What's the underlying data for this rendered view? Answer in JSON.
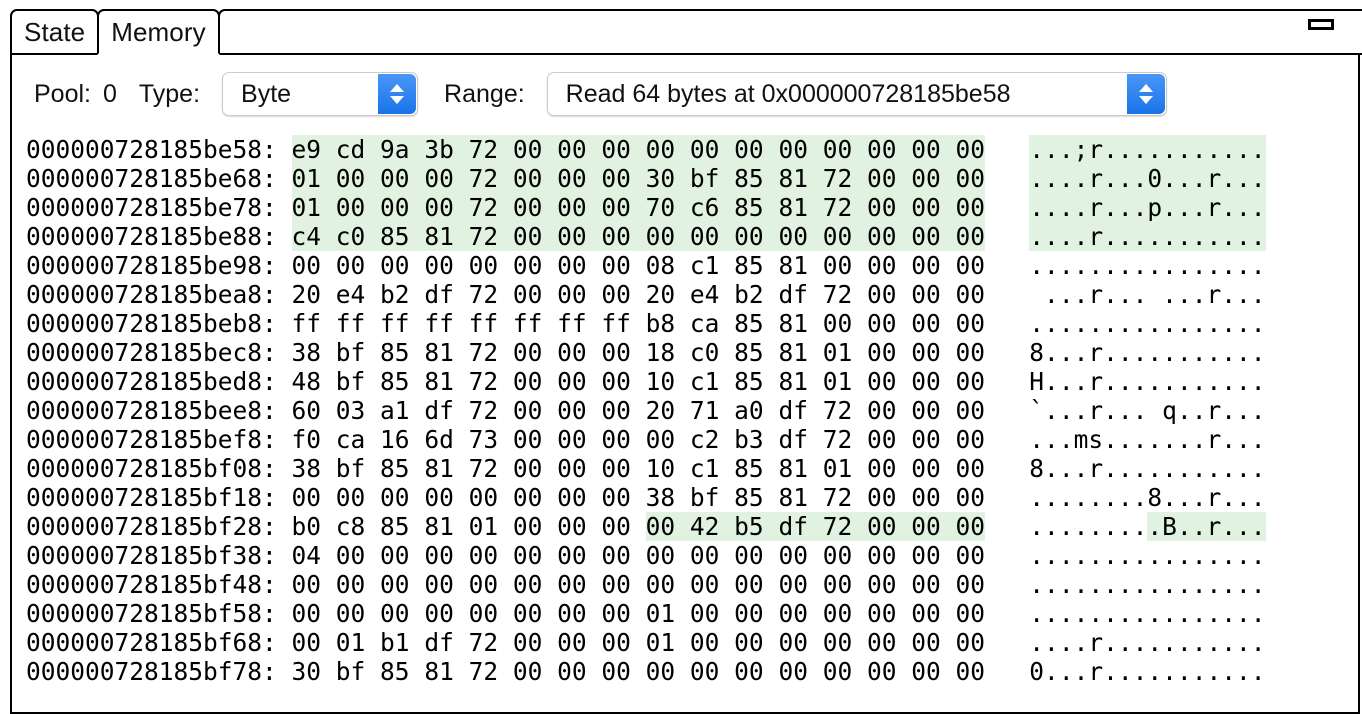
{
  "window": {
    "minimize_icon": "minimize-icon"
  },
  "tabs": [
    {
      "label": "State",
      "active": false
    },
    {
      "label": "Memory",
      "active": true
    }
  ],
  "toolbar": {
    "pool_label": "Pool:",
    "pool_value": "0",
    "type_label": "Type:",
    "type_value": "Byte",
    "type_options": [
      "Byte"
    ],
    "range_label": "Range:",
    "range_value": "Read 64 bytes at 0x000000728185be58",
    "range_options": [
      "Read 64 bytes at 0x000000728185be58"
    ],
    "stepper_icon": "chevron-up-down-icon"
  },
  "colors": {
    "highlight": "#e1f3e0",
    "stepper_blue": "#1a74e8",
    "text": "#000000",
    "background": "#ffffff"
  },
  "memory": {
    "bytes_per_row": 16,
    "rows": [
      {
        "address": "000000728185be58",
        "bytes": [
          "e9",
          "cd",
          "9a",
          "3b",
          "72",
          "00",
          "00",
          "00",
          "00",
          "00",
          "00",
          "00",
          "00",
          "00",
          "00",
          "00"
        ],
        "ascii": "...;r...........",
        "highlight": [
          0,
          16
        ]
      },
      {
        "address": "000000728185be68",
        "bytes": [
          "01",
          "00",
          "00",
          "00",
          "72",
          "00",
          "00",
          "00",
          "30",
          "bf",
          "85",
          "81",
          "72",
          "00",
          "00",
          "00"
        ],
        "ascii": "....r...0...r...",
        "highlight": [
          0,
          16
        ]
      },
      {
        "address": "000000728185be78",
        "bytes": [
          "01",
          "00",
          "00",
          "00",
          "72",
          "00",
          "00",
          "00",
          "70",
          "c6",
          "85",
          "81",
          "72",
          "00",
          "00",
          "00"
        ],
        "ascii": "....r...p...r...",
        "highlight": [
          0,
          16
        ]
      },
      {
        "address": "000000728185be88",
        "bytes": [
          "c4",
          "c0",
          "85",
          "81",
          "72",
          "00",
          "00",
          "00",
          "00",
          "00",
          "00",
          "00",
          "00",
          "00",
          "00",
          "00"
        ],
        "ascii": "....r...........",
        "highlight": [
          0,
          16
        ]
      },
      {
        "address": "000000728185be98",
        "bytes": [
          "00",
          "00",
          "00",
          "00",
          "00",
          "00",
          "00",
          "00",
          "08",
          "c1",
          "85",
          "81",
          "00",
          "00",
          "00",
          "00"
        ],
        "ascii": "................",
        "highlight": null
      },
      {
        "address": "000000728185bea8",
        "bytes": [
          "20",
          "e4",
          "b2",
          "df",
          "72",
          "00",
          "00",
          "00",
          "20",
          "e4",
          "b2",
          "df",
          "72",
          "00",
          "00",
          "00"
        ],
        "ascii": " ...r... ...r...",
        "highlight": null
      },
      {
        "address": "000000728185beb8",
        "bytes": [
          "ff",
          "ff",
          "ff",
          "ff",
          "ff",
          "ff",
          "ff",
          "ff",
          "b8",
          "ca",
          "85",
          "81",
          "00",
          "00",
          "00",
          "00"
        ],
        "ascii": "................",
        "highlight": null
      },
      {
        "address": "000000728185bec8",
        "bytes": [
          "38",
          "bf",
          "85",
          "81",
          "72",
          "00",
          "00",
          "00",
          "18",
          "c0",
          "85",
          "81",
          "01",
          "00",
          "00",
          "00"
        ],
        "ascii": "8...r...........",
        "highlight": null
      },
      {
        "address": "000000728185bed8",
        "bytes": [
          "48",
          "bf",
          "85",
          "81",
          "72",
          "00",
          "00",
          "00",
          "10",
          "c1",
          "85",
          "81",
          "01",
          "00",
          "00",
          "00"
        ],
        "ascii": "H...r...........",
        "highlight": null
      },
      {
        "address": "000000728185bee8",
        "bytes": [
          "60",
          "03",
          "a1",
          "df",
          "72",
          "00",
          "00",
          "00",
          "20",
          "71",
          "a0",
          "df",
          "72",
          "00",
          "00",
          "00"
        ],
        "ascii": "`...r... q..r...",
        "highlight": null
      },
      {
        "address": "000000728185bef8",
        "bytes": [
          "f0",
          "ca",
          "16",
          "6d",
          "73",
          "00",
          "00",
          "00",
          "00",
          "c2",
          "b3",
          "df",
          "72",
          "00",
          "00",
          "00"
        ],
        "ascii": "...ms.......r...",
        "highlight": null
      },
      {
        "address": "000000728185bf08",
        "bytes": [
          "38",
          "bf",
          "85",
          "81",
          "72",
          "00",
          "00",
          "00",
          "10",
          "c1",
          "85",
          "81",
          "01",
          "00",
          "00",
          "00"
        ],
        "ascii": "8...r...........",
        "highlight": null
      },
      {
        "address": "000000728185bf18",
        "bytes": [
          "00",
          "00",
          "00",
          "00",
          "00",
          "00",
          "00",
          "00",
          "38",
          "bf",
          "85",
          "81",
          "72",
          "00",
          "00",
          "00"
        ],
        "ascii": "........8...r...",
        "highlight": null
      },
      {
        "address": "000000728185bf28",
        "bytes": [
          "b0",
          "c8",
          "85",
          "81",
          "01",
          "00",
          "00",
          "00",
          "00",
          "42",
          "b5",
          "df",
          "72",
          "00",
          "00",
          "00"
        ],
        "ascii": ".........B..r...",
        "highlight": [
          8,
          16
        ]
      },
      {
        "address": "000000728185bf38",
        "bytes": [
          "04",
          "00",
          "00",
          "00",
          "00",
          "00",
          "00",
          "00",
          "00",
          "00",
          "00",
          "00",
          "00",
          "00",
          "00",
          "00"
        ],
        "ascii": "................",
        "highlight": null
      },
      {
        "address": "000000728185bf48",
        "bytes": [
          "00",
          "00",
          "00",
          "00",
          "00",
          "00",
          "00",
          "00",
          "00",
          "00",
          "00",
          "00",
          "00",
          "00",
          "00",
          "00"
        ],
        "ascii": "................",
        "highlight": null
      },
      {
        "address": "000000728185bf58",
        "bytes": [
          "00",
          "00",
          "00",
          "00",
          "00",
          "00",
          "00",
          "00",
          "01",
          "00",
          "00",
          "00",
          "00",
          "00",
          "00",
          "00"
        ],
        "ascii": "................",
        "highlight": null
      },
      {
        "address": "000000728185bf68",
        "bytes": [
          "00",
          "01",
          "b1",
          "df",
          "72",
          "00",
          "00",
          "00",
          "01",
          "00",
          "00",
          "00",
          "00",
          "00",
          "00",
          "00"
        ],
        "ascii": "....r...........",
        "highlight": null
      },
      {
        "address": "000000728185bf78",
        "bytes": [
          "30",
          "bf",
          "85",
          "81",
          "72",
          "00",
          "00",
          "00",
          "00",
          "00",
          "00",
          "00",
          "00",
          "00",
          "00",
          "00"
        ],
        "ascii": "0...r...........",
        "highlight": null
      }
    ]
  }
}
